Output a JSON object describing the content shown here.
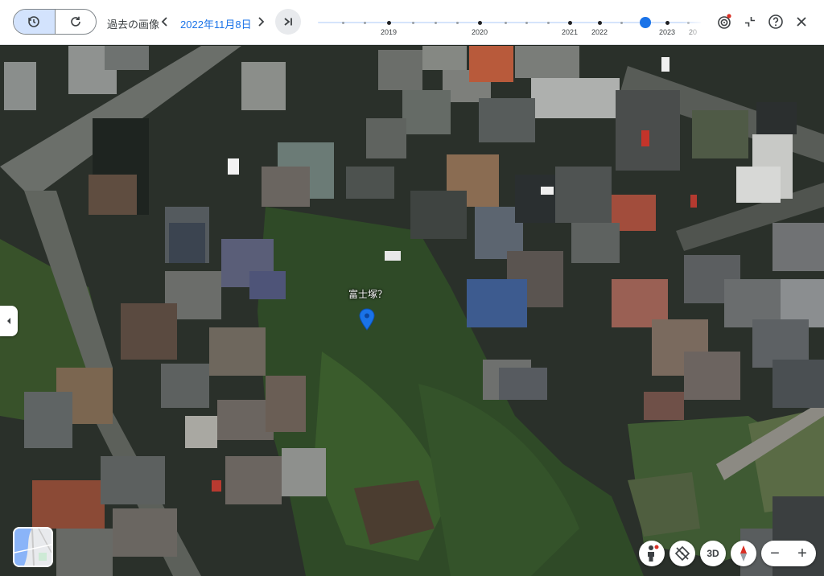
{
  "toolbar": {
    "history_label": "過去の画像",
    "date": "2022年11月8日",
    "years": [
      "2019",
      "2020",
      "2021",
      "2022",
      "2023",
      "20"
    ],
    "history_toggle_icon": "history-clock-icon",
    "current_toggle_icon": "refresh-icon",
    "prev_icon": "chevron-left-icon",
    "next_icon": "chevron-right-icon",
    "latest_icon": "skip-to-latest-icon",
    "tools": [
      "animation-icon",
      "collapse-icon",
      "help-icon",
      "close-icon"
    ]
  },
  "map": {
    "place_label": "富士塚？",
    "pin_color": "#1a73e8"
  },
  "controls": {
    "three_d_label": "3D",
    "zoom_out": "−",
    "zoom_in": "+",
    "icons": [
      "pegman-icon",
      "tilt-off-icon",
      "compass-icon"
    ]
  },
  "colors": {
    "accent": "#1a73e8",
    "timeline_track": "#d5e4fb",
    "active_toggle": "#d3e3fd"
  }
}
